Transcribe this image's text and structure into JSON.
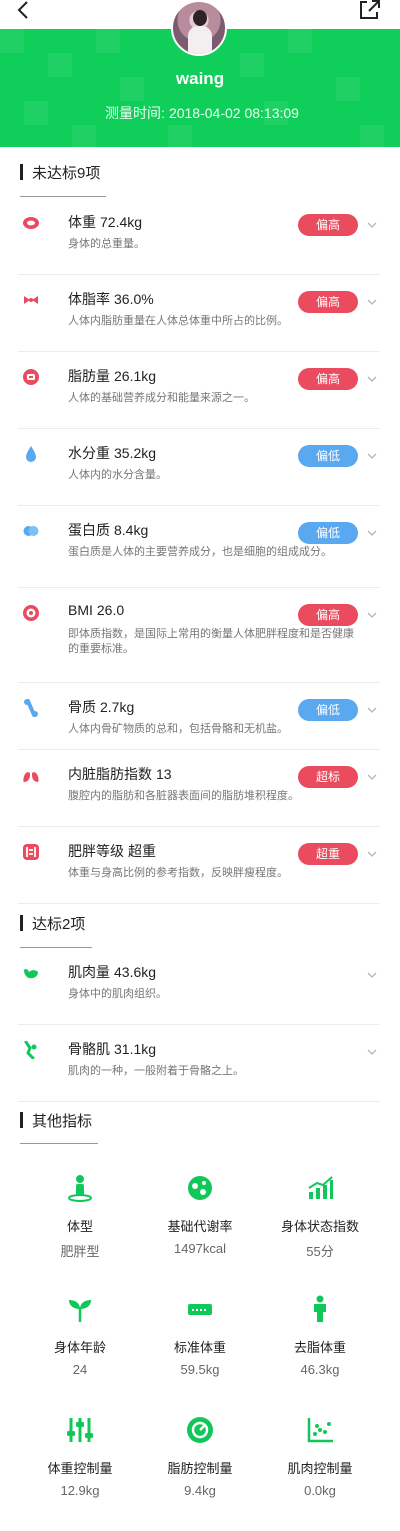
{
  "header": {
    "username": "waing",
    "time_label": "测量时间:",
    "time_value": "2018-04-02 08:13:09"
  },
  "colors": {
    "brand": "#0fce5a",
    "high": "#ea4b5f",
    "low": "#5aa9f0",
    "good": "#10c85a"
  },
  "unmet": {
    "title": "未达标9项",
    "items": [
      {
        "icon": "weight-icon",
        "name": "体重",
        "value": "72.4kg",
        "desc": "身体的总重量。",
        "badge": "偏高",
        "level": "high"
      },
      {
        "icon": "body-fat-rate-icon",
        "name": "体脂率",
        "value": "36.0%",
        "desc": "人体内脂肪重量在人体总体重中所占的比例。",
        "badge": "偏高",
        "level": "high"
      },
      {
        "icon": "fat-mass-icon",
        "name": "脂肪量",
        "value": "26.1kg",
        "desc": "人体的基础营养成分和能量来源之一。",
        "badge": "偏高",
        "level": "high"
      },
      {
        "icon": "water-drop-icon",
        "name": "水分重",
        "value": "35.2kg",
        "desc": "人体内的水分含量。",
        "badge": "偏低",
        "level": "low"
      },
      {
        "icon": "protein-icon",
        "name": "蛋白质",
        "value": "8.4kg",
        "desc": "蛋白质是人体的主要营养成分，也是细胞的组成成分。",
        "badge": "偏低",
        "level": "low"
      },
      {
        "icon": "bmi-icon",
        "name": "BMI",
        "value": "26.0",
        "desc": "即体质指数，是国际上常用的衡量人体肥胖程度和是否健康的重要标准。",
        "badge": "偏高",
        "level": "high"
      },
      {
        "icon": "bone-icon",
        "name": "骨质",
        "value": "2.7kg",
        "desc": "人体内骨矿物质的总和，包括骨骼和无机盐。",
        "badge": "偏低",
        "level": "low"
      },
      {
        "icon": "lungs-icon",
        "name": "内脏脂肪指数",
        "value": "13",
        "desc": "腹腔内的脂肪和各脏器表面间的脂肪堆积程度。",
        "badge": "超标",
        "level": "high"
      },
      {
        "icon": "obesity-level-icon",
        "name": "肥胖等级",
        "value": "超重",
        "desc": "体重与身高比例的参考指数，反映胖瘦程度。",
        "badge": "超重",
        "level": "high"
      }
    ]
  },
  "met": {
    "title": "达标2项",
    "items": [
      {
        "icon": "muscle-arm-icon",
        "name": "肌肉量",
        "value": "43.6kg",
        "desc": "身体中的肌肉组织。"
      },
      {
        "icon": "skeletal-muscle-icon",
        "name": "骨骼肌",
        "value": "31.1kg",
        "desc": "肌肉的一种，一般附着于骨骼之上。"
      }
    ]
  },
  "other": {
    "title": "其他指标",
    "items": [
      {
        "icon": "body-type-icon",
        "label": "体型",
        "value": "肥胖型"
      },
      {
        "icon": "metabolism-icon",
        "label": "基础代谢率",
        "value": "1497kcal"
      },
      {
        "icon": "body-status-chart-icon",
        "label": "身体状态指数",
        "value": "55分"
      },
      {
        "icon": "sprout-icon",
        "label": "身体年龄",
        "value": "24"
      },
      {
        "icon": "scale-icon",
        "label": "标准体重",
        "value": "59.5kg"
      },
      {
        "icon": "person-icon",
        "label": "去脂体重",
        "value": "46.3kg"
      },
      {
        "icon": "sliders-icon",
        "label": "体重控制量",
        "value": "12.9kg"
      },
      {
        "icon": "gauge-icon",
        "label": "脂肪控制量",
        "value": "9.4kg"
      },
      {
        "icon": "scatter-chart-icon",
        "label": "肌肉控制量",
        "value": "0.0kg"
      }
    ]
  }
}
